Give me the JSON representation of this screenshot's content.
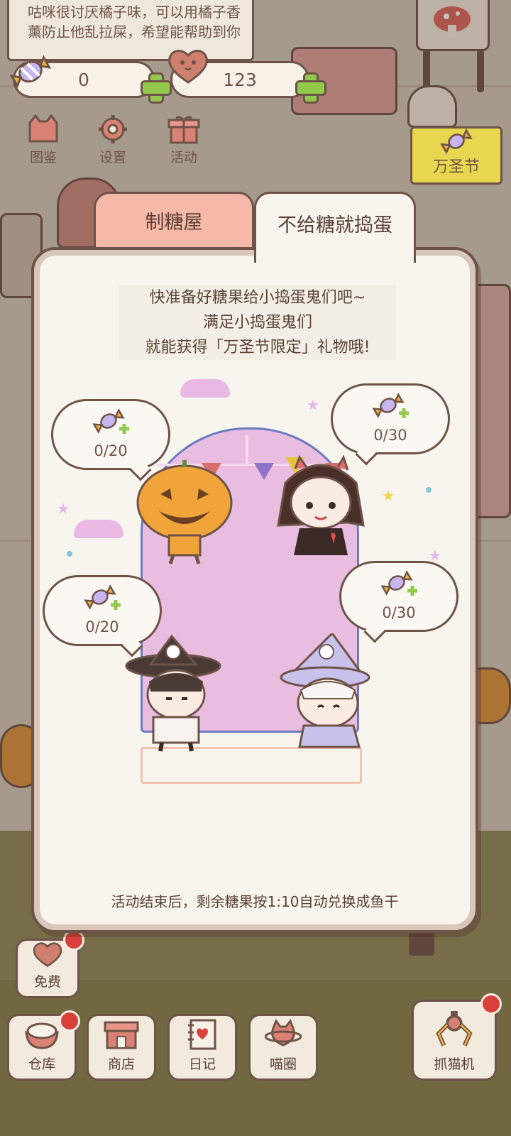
{
  "hud": {
    "note_text": "咕咪很讨厌橘子味，可以用橘子香薰防止他乱拉屎，希望能帮助到你",
    "candy_count": "0",
    "heart_count": "123"
  },
  "top_menu": [
    {
      "label": "图鉴",
      "icon": "cat-book-icon"
    },
    {
      "label": "设置",
      "icon": "gear-icon"
    },
    {
      "label": "活动",
      "icon": "gift-icon"
    }
  ],
  "halloween_sign_label": "万圣节",
  "tabs": {
    "inactive": "制糖屋",
    "active": "不给糖就捣蛋"
  },
  "dialog": {
    "intro_line1": "快准备好糖果给小捣蛋鬼们吧~",
    "intro_line2": "满足小捣蛋鬼们",
    "intro_line3": "就能获得「万圣节限定」礼物哦!",
    "footer": "活动结束后，剩余糖果按1:10自动兑换成鱼干"
  },
  "characters": [
    {
      "name": "pumpkin",
      "progress": "0/20"
    },
    {
      "name": "devil-girl",
      "progress": "0/30"
    },
    {
      "name": "witch-boy",
      "progress": "0/20"
    },
    {
      "name": "ghost-hat-kid",
      "progress": "0/30"
    }
  ],
  "bottom_bar": {
    "free": "免费",
    "warehouse": "仓库",
    "shop": "商店",
    "diary": "日记",
    "circle": "喵圈",
    "claw": "抓猫机"
  },
  "colors": {
    "outline": "#6e5348",
    "tab_inactive": "#f6b8a8",
    "panel": "#f8f5ef",
    "plus_green": "#93c94a",
    "badge_red": "#d9403a"
  }
}
